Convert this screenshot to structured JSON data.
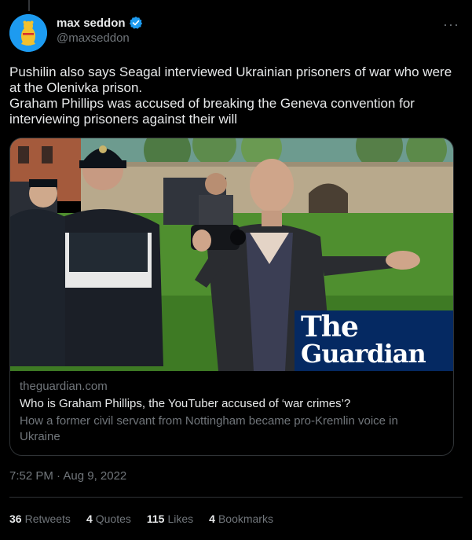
{
  "colors": {
    "background": "#000000",
    "text_primary": "#e7e9ea",
    "text_secondary": "#71767b",
    "verified_badge": "#1d9bf0",
    "border": "#2f3336",
    "guardian_blue": "#052962"
  },
  "author": {
    "display_name": "max seddon",
    "handle": "@maxseddon",
    "verified_icon": "verified-badge-icon",
    "avatar_icon": "bear-avatar-icon"
  },
  "more_icon": "more-options-icon",
  "more_glyph": "···",
  "tweet": {
    "text": "Pushilin also says Seagal interviewed Ukrainian prisoners of war who were at the Olenivka prison.\nGraham Phillips was accused of breaking the Geneva convention for interviewing prisoners against their will"
  },
  "card": {
    "image_logo_line1": "The",
    "image_logo_line2": "Guardian",
    "domain": "theguardian.com",
    "title": "Who is Graham Phillips, the YouTuber accused of ‘war crimes’?",
    "description": "How a former civil servant from Nottingham became pro-Kremlin voice in Ukraine"
  },
  "timestamp": "7:52 PM · Aug 9, 2022",
  "stats": {
    "retweets": {
      "count": "36",
      "label": "Retweets"
    },
    "quotes": {
      "count": "4",
      "label": "Quotes"
    },
    "likes": {
      "count": "115",
      "label": "Likes"
    },
    "bookmarks": {
      "count": "4",
      "label": "Bookmarks"
    }
  }
}
